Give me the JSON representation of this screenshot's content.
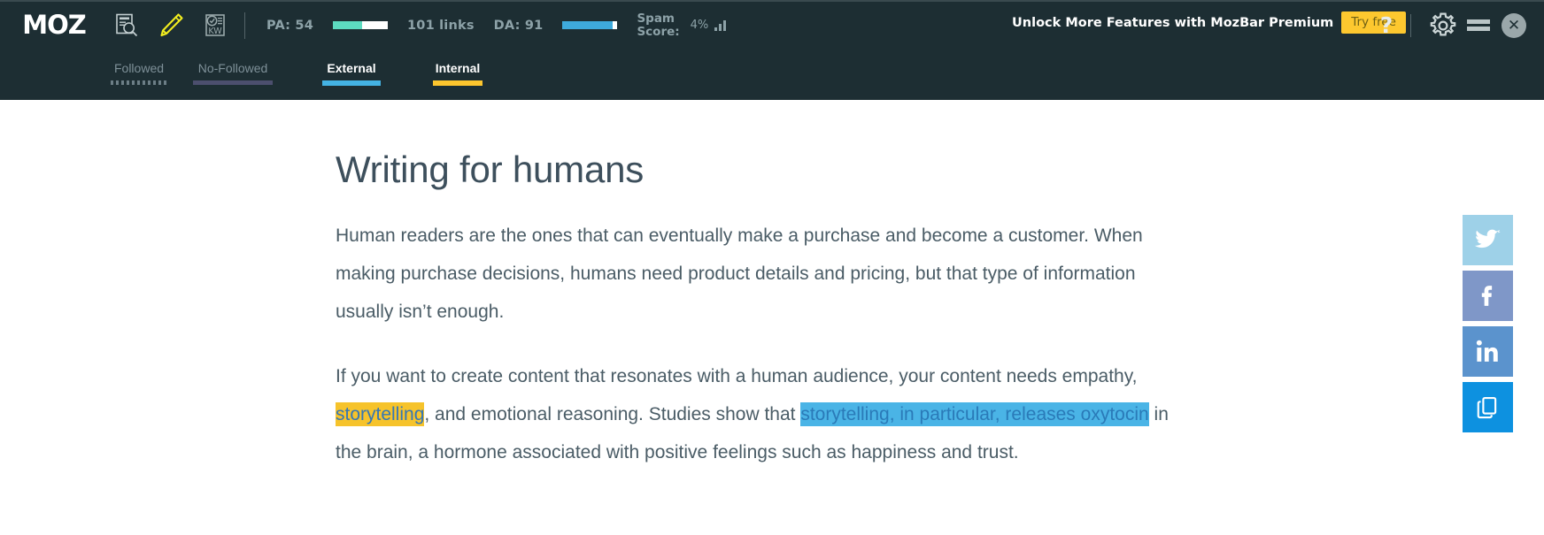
{
  "mozbar": {
    "logo": "MOZ",
    "left_icons": [
      {
        "name": "page-analysis-icon",
        "label": "Page Analysis"
      },
      {
        "name": "highlighter-pencil-icon",
        "label": "Highlighter"
      },
      {
        "name": "keyword-difficulty-icon",
        "label": "KW"
      }
    ],
    "metrics": {
      "pa_label": "PA: 54",
      "pa_value": 54,
      "links_label": "101 links",
      "da_label": "DA: 91",
      "da_value": 91,
      "spam_label_line1": "Spam",
      "spam_label_line2": "Score:",
      "spam_value": "4%"
    },
    "promo": {
      "text": "Unlock More Features with MozBar Premium",
      "button_label": "Try free",
      "button_color": "#fdc82f"
    },
    "window_controls": {
      "help_glyph": "?",
      "gear_name": "gear-icon",
      "minimize_name": "minimize-icon",
      "close_glyph": "✕"
    },
    "link_tabs": [
      {
        "label": "Followed",
        "active": false,
        "rule_color": "#6c7e86",
        "rule_style": "dotted"
      },
      {
        "label": "No-Followed",
        "active": false,
        "rule_color": "#4c4f6e",
        "rule_style": "solid"
      },
      {
        "label": "External",
        "active": true,
        "rule_color": "#44b3e4",
        "rule_style": "solid"
      },
      {
        "label": "Internal",
        "active": true,
        "rule_color": "#fdc62e",
        "rule_style": "solid"
      }
    ],
    "highlight": {
      "input_value": "",
      "input_placeholder": "",
      "tab_label": "Highlight",
      "rule_color": "#f7f41e"
    }
  },
  "article": {
    "title": "Writing for humans",
    "paragraph1": "Human readers are the ones that can eventually make a purchase and become a customer. When making purchase decisions, humans need product details and pricing, but that type of information usually isn’t enough.",
    "paragraph2": {
      "part1": "If you want to create content that resonates with a human audience, your content needs empathy, ",
      "highlight_yellow": "storytelling",
      "part2": ", and emotional reasoning. Studies show that ",
      "highlight_blue": "storytelling, in particular, releases oxytocin",
      "part3": " in the brain, a hormone associated with positive feelings such as happiness and trust."
    }
  },
  "social_rail": [
    {
      "name": "twitter-share-button",
      "glyph": "🐦",
      "color": "#9ed1e8"
    },
    {
      "name": "facebook-share-button",
      "glyph": "f",
      "color": "#7f97c8"
    },
    {
      "name": "linkedin-share-button",
      "glyph": "in",
      "color": "#5b93cd"
    },
    {
      "name": "copy-link-button",
      "glyph": "⧉",
      "color": "#0d91e0"
    }
  ]
}
